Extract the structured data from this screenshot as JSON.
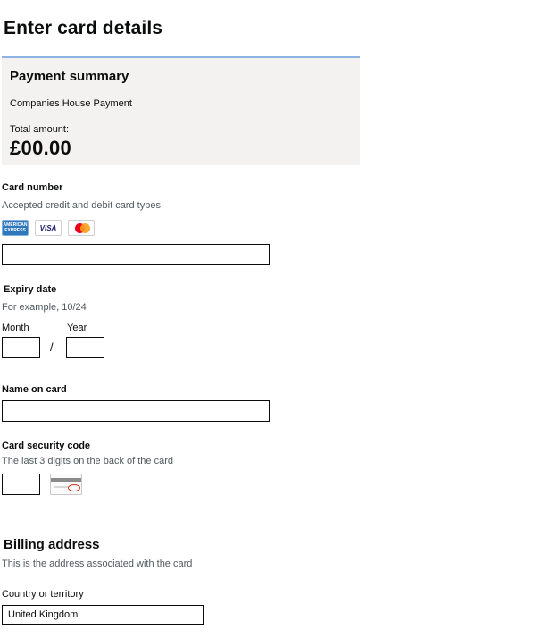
{
  "page": {
    "title": "Enter card details"
  },
  "summary": {
    "title": "Payment summary",
    "description": "Companies House Payment",
    "total_label": "Total amount:",
    "amount": "£00.00"
  },
  "card_number": {
    "label": "Card number",
    "hint": "Accepted credit and debit card types",
    "logos": [
      {
        "icon": "amex-logo-icon",
        "text": "AMERICAN EXPRESS"
      },
      {
        "icon": "visa-logo-icon",
        "text": "VISA"
      },
      {
        "icon": "mastercard-logo-icon",
        "text": ""
      }
    ],
    "value": ""
  },
  "expiry": {
    "label": "Expiry date",
    "hint": "For example, 10/24",
    "month_label": "Month",
    "year_label": "Year",
    "separator": "/",
    "month_value": "",
    "year_value": ""
  },
  "name_on_card": {
    "label": "Name on card",
    "value": ""
  },
  "security_code": {
    "label": "Card security code",
    "hint": "The last 3 digits on the back of the card",
    "value": "",
    "illustration_icon": "card-back-cvv-icon"
  },
  "billing": {
    "title": "Billing address",
    "hint": "This is the address associated with the card",
    "country_label": "Country or territory",
    "country_value": "United Kingdom"
  },
  "colors": {
    "summary_bg": "#f3f2f1",
    "summary_border": "#8fb4e2",
    "text": "#0b0c0c",
    "hint": "#505a5f"
  }
}
